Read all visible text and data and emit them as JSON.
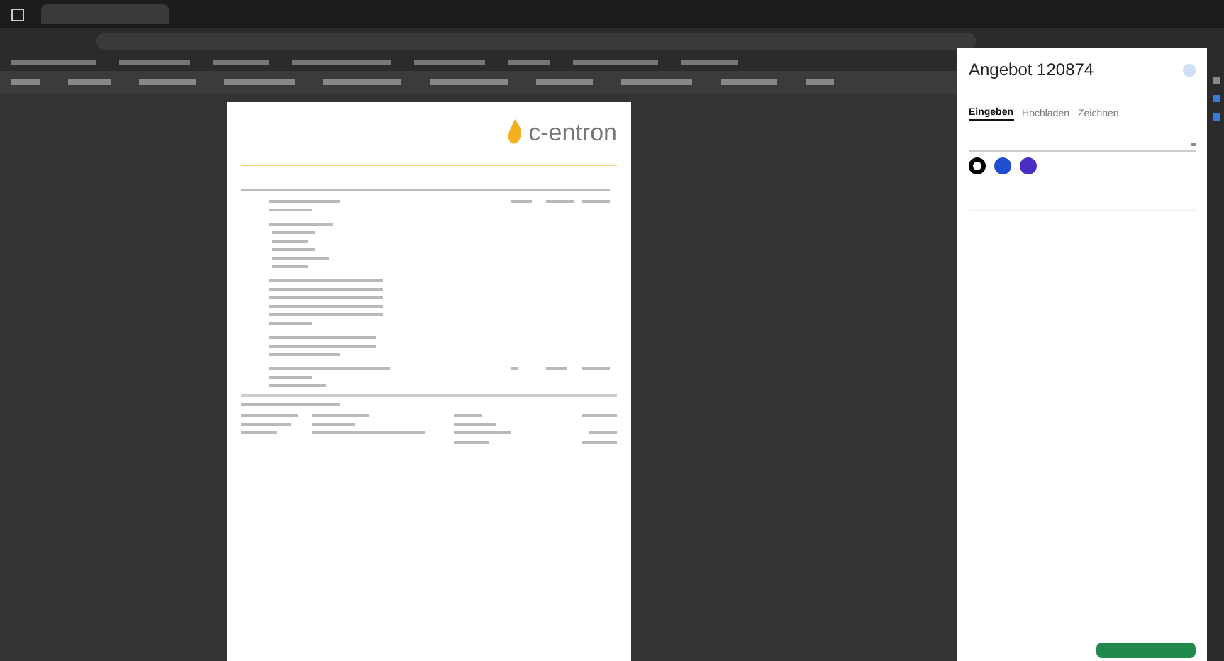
{
  "document": {
    "logo": "c-entron"
  },
  "panel": {
    "title": "Angebot 120874",
    "tabs": [
      {
        "label": "Eingeben",
        "selected": true
      },
      {
        "label": "Hochladen",
        "selected": false
      },
      {
        "label": "Zeichnen",
        "selected": false
      }
    ],
    "colors": [
      {
        "color": "#000000",
        "selected": true
      },
      {
        "color": "#1f4fd0",
        "selected": false
      },
      {
        "color": "#4a2ec4",
        "selected": false
      }
    ]
  }
}
